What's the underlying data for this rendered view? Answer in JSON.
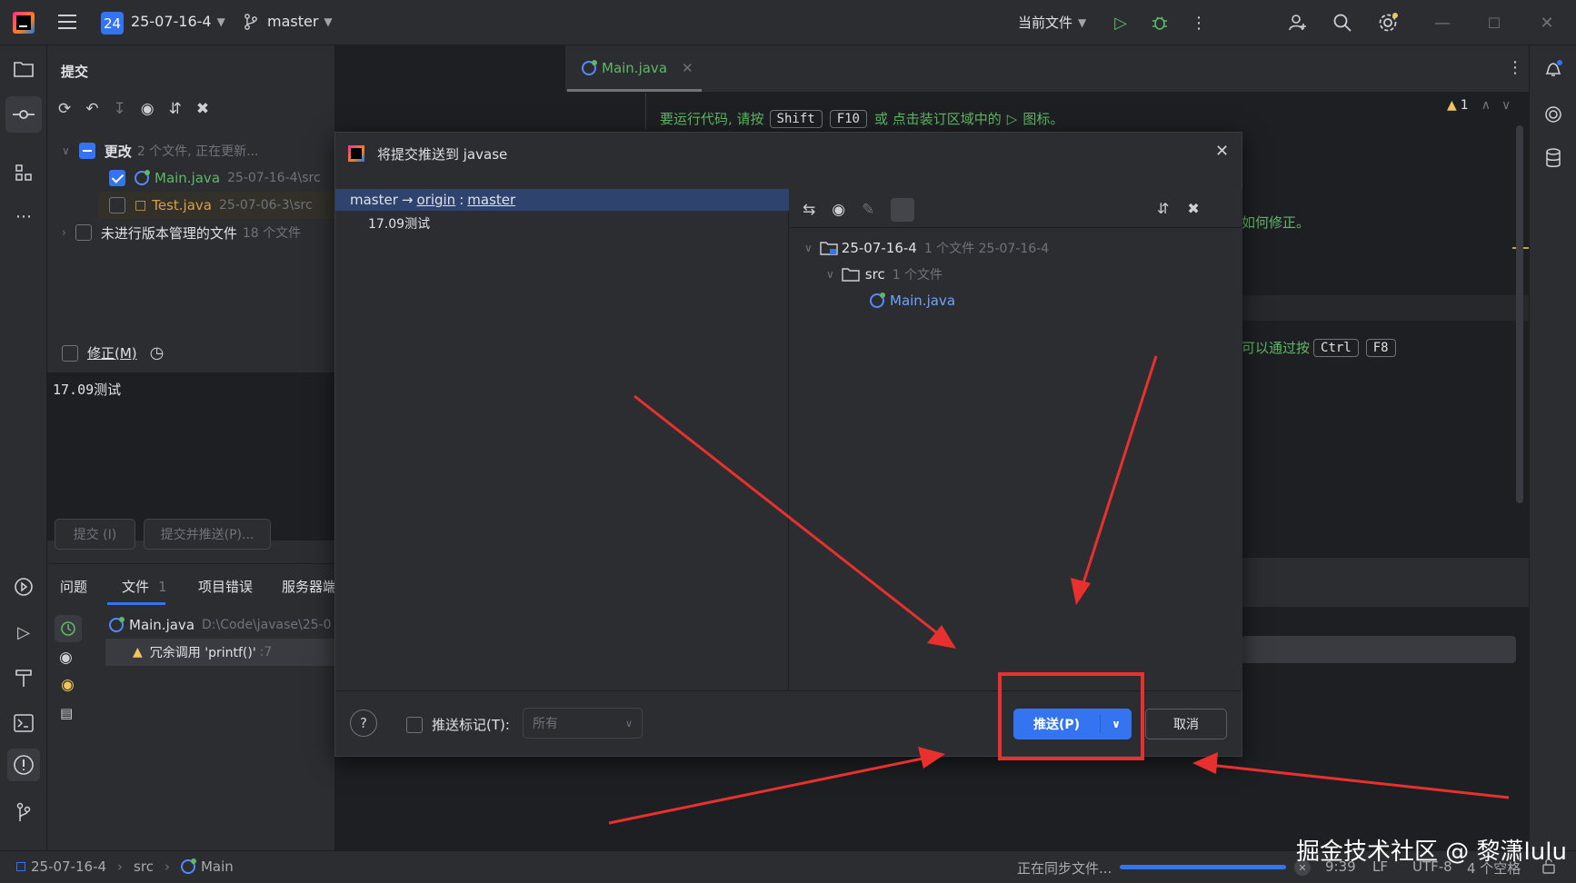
{
  "titlebar": {
    "project_badge": "24",
    "project_name": "25-07-16-4",
    "branch": "master",
    "run_config": "当前文件"
  },
  "commit_panel": {
    "title": "提交",
    "changes_label": "更改",
    "changes_meta": "2 个文件, 正在更新...",
    "files": [
      {
        "name": "Main.java",
        "path": "25-07-16-4\\src",
        "checked": true
      },
      {
        "name": "Test.java",
        "path": "25-07-06-3\\src",
        "checked": false
      }
    ],
    "unversioned_label": "未进行版本管理的文件",
    "unversioned_meta": "18 个文件",
    "amend_label": "修正(M)",
    "message": "17.09测试",
    "commit_button": "提交 (I)",
    "commit_push_button": "提交并推送(P)..."
  },
  "problems_panel": {
    "tabs": [
      {
        "label": "问题"
      },
      {
        "label": "文件",
        "count": "1"
      },
      {
        "label": "项目错误"
      },
      {
        "label": "服务器端"
      }
    ],
    "file_name": "Main.java",
    "file_path": "D:\\Code\\javase\\25-0",
    "warning": "冗余调用 'printf()'",
    "warning_line": ":7"
  },
  "editor": {
    "tab_label": "Main.java",
    "warning_count": "1",
    "hint_prefix": "要运行代码, 请按",
    "hint_key1": "Shift",
    "hint_key2": "F10",
    "hint_mid": "或 点击装订区域中的",
    "hint_suffix": "图标。",
    "line2_fragment": "如何修正。",
    "line3_fragment": "可以通过按",
    "line3_key1": "Ctrl",
    "line3_key2": "F8"
  },
  "push_dialog": {
    "title": "将提交推送到 javase",
    "branch_local": "master",
    "arrow": "→",
    "remote": "origin",
    "separator": ":",
    "branch_remote": "master",
    "commit_message": "17.09测试",
    "tree": {
      "root": "25-07-16-4",
      "root_meta": "1 个文件 25-07-16-4",
      "folder": "src",
      "folder_meta": "1 个文件",
      "file": "Main.java"
    },
    "push_tags_label": "推送标记(T):",
    "tags_select": "所有",
    "push_button": "推送(P)",
    "cancel_button": "取消",
    "help": "?"
  },
  "statusbar": {
    "crumb_project": "25-07-16-4",
    "crumb_folder": "src",
    "crumb_class": "Main",
    "sync_text": "正在同步文件...",
    "progress": 1.0,
    "time": "9:39",
    "line_sep": "LF",
    "encoding": "UTF-8",
    "indent": "4 个空格"
  },
  "watermark": "掘金技术社区 @ 黎潇lulu",
  "colors": {
    "accent": "#3574f0",
    "annotation": "#e8312f",
    "modified_file": "#5fb865",
    "orange_file": "#d6a04a"
  }
}
